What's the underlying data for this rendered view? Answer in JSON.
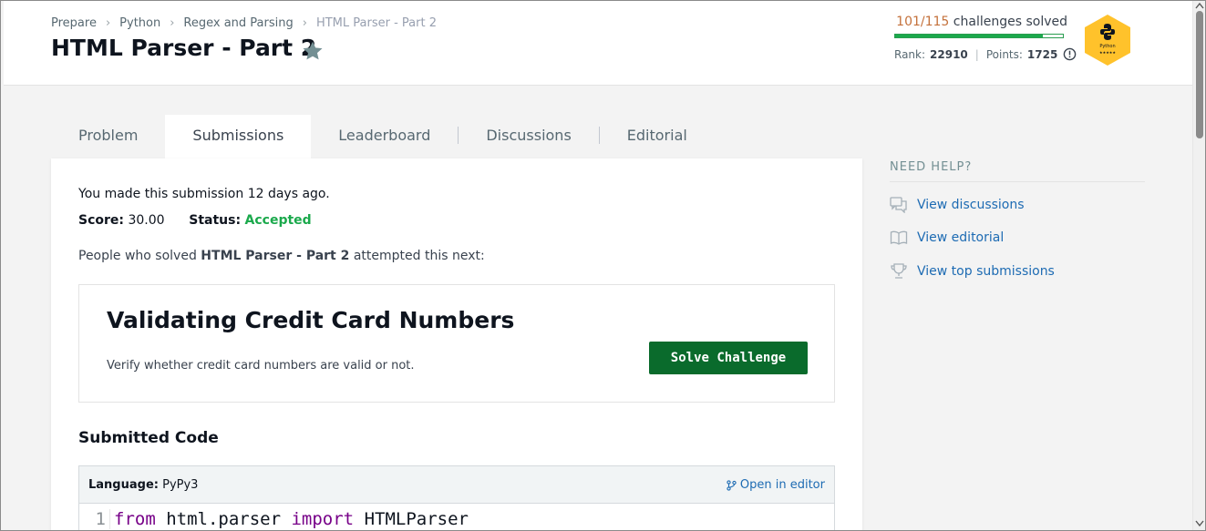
{
  "breadcrumb": {
    "items": [
      "Prepare",
      "Python",
      "Regex and Parsing",
      "HTML Parser - Part 2"
    ]
  },
  "title": "HTML Parser - Part 2",
  "progress": {
    "count": "101/115",
    "suffix": " challenges solved",
    "fraction": 0.878
  },
  "rank": {
    "rank_label": "Rank:",
    "rank_value": "22910",
    "points_label": "Points:",
    "points_value": "1725"
  },
  "badge": {
    "label": "Python",
    "stars": "★★★★★",
    "color": "#ffc22b"
  },
  "tabs": [
    {
      "label": "Problem"
    },
    {
      "label": "Submissions"
    },
    {
      "label": "Leaderboard"
    },
    {
      "label": "Discussions"
    },
    {
      "label": "Editorial"
    }
  ],
  "submission": {
    "time_text": "You made this submission 12 days ago.",
    "score_label": "Score:",
    "score_value": "30.00",
    "status_label": "Status:",
    "status_value": "Accepted",
    "people_prefix": "People who solved ",
    "people_bold": "HTML Parser - Part 2",
    "people_suffix": " attempted this next:"
  },
  "next_challenge": {
    "title": "Validating Credit Card Numbers",
    "description": "Verify whether credit card numbers are valid or not.",
    "button_label": "Solve Challenge"
  },
  "code": {
    "heading": "Submitted Code",
    "language_label": "Language:",
    "language_value": "PyPy3",
    "open_editor": "Open in editor",
    "line_number": "1",
    "kw1": "from",
    "mod": " html.parser ",
    "kw2": "import",
    "name": " HTMLParser"
  },
  "help": {
    "heading": "NEED HELP?",
    "items": [
      {
        "label": "View discussions",
        "icon": "discussion-icon"
      },
      {
        "label": "View editorial",
        "icon": "book-icon"
      },
      {
        "label": "View top submissions",
        "icon": "trophy-icon"
      }
    ]
  },
  "colors": {
    "accent_green": "#1ba94c",
    "button_green": "#0a6b2c",
    "link_blue": "#1d6bb3"
  }
}
